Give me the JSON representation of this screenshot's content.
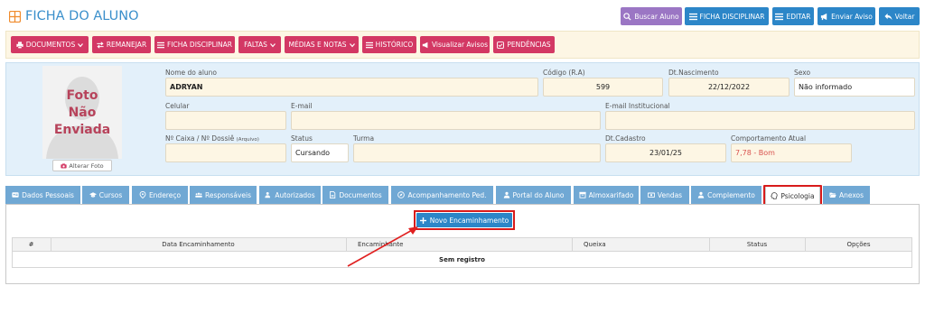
{
  "header": {
    "title": "FICHA DO ALUNO",
    "buttons": [
      {
        "label": "Buscar Aluno",
        "color": "#9b59b6"
      },
      {
        "label": "FICHA DISCIPLINAR",
        "color": "#2c86c8"
      },
      {
        "label": "EDITAR",
        "color": "#2c86c8"
      },
      {
        "label": "Enviar Aviso",
        "color": "#2c86c8"
      },
      {
        "label": "Voltar",
        "color": "#2c86c8"
      }
    ]
  },
  "actions": [
    {
      "label": "DOCUMENTOS"
    },
    {
      "label": "REMANEJAR"
    },
    {
      "label": "FICHA DISCIPLINAR"
    },
    {
      "label": "FALTAS"
    },
    {
      "label": "MÉDIAS E NOTAS"
    },
    {
      "label": "HISTÓRICO"
    },
    {
      "label": "Visualizar Avisos"
    },
    {
      "label": "PENDÊNCIAS"
    }
  ],
  "student": {
    "photo_text": [
      "Foto",
      "Não",
      "Enviada"
    ],
    "alter_photo": "Alterar Foto",
    "fields": {
      "nome": {
        "label": "Nome do aluno",
        "value": "ADRYAN"
      },
      "codigo": {
        "label": "Código (R.A)",
        "value": "599"
      },
      "nascimento": {
        "label": "Dt.Nascimento",
        "value": "22/12/2022"
      },
      "sexo": {
        "label": "Sexo",
        "value": "Não informado"
      },
      "celular": {
        "label": "Celular",
        "value": ""
      },
      "email": {
        "label": "E-mail",
        "value": ""
      },
      "email_inst": {
        "label": "E-mail Institucional",
        "value": ""
      },
      "caixa": {
        "label": "Nº Caixa / Nº Dossiê",
        "label_small": "(Arquivo)",
        "value": ""
      },
      "status": {
        "label": "Status",
        "value": "Cursando"
      },
      "turma": {
        "label": "Turma",
        "value": ""
      },
      "cadastro": {
        "label": "Dt.Cadastro",
        "value": "23/01/25"
      },
      "comportamento": {
        "label": "Comportamento Atual",
        "value": "7,78 - Bom",
        "color": "#d9534f"
      }
    }
  },
  "tabs": [
    {
      "label": "Dados Pessoais"
    },
    {
      "label": "Cursos"
    },
    {
      "label": "Endereço"
    },
    {
      "label": "Responsáveis"
    },
    {
      "label": "Autorizados"
    },
    {
      "label": "Documentos"
    },
    {
      "label": "Acompanhamento Ped."
    },
    {
      "label": "Portal do Aluno"
    },
    {
      "label": "Almoxarifado"
    },
    {
      "label": "Vendas"
    },
    {
      "label": "Complemento"
    },
    {
      "label": "Psicologia",
      "active": true
    },
    {
      "label": "Anexos"
    }
  ],
  "psicologia": {
    "new_button": "Novo Encaminhamento",
    "columns": [
      "#",
      "Data Encaminhamento",
      "Encaminhante",
      "Queixa",
      "Status",
      "Opções"
    ],
    "empty_text": "Sem registro"
  }
}
